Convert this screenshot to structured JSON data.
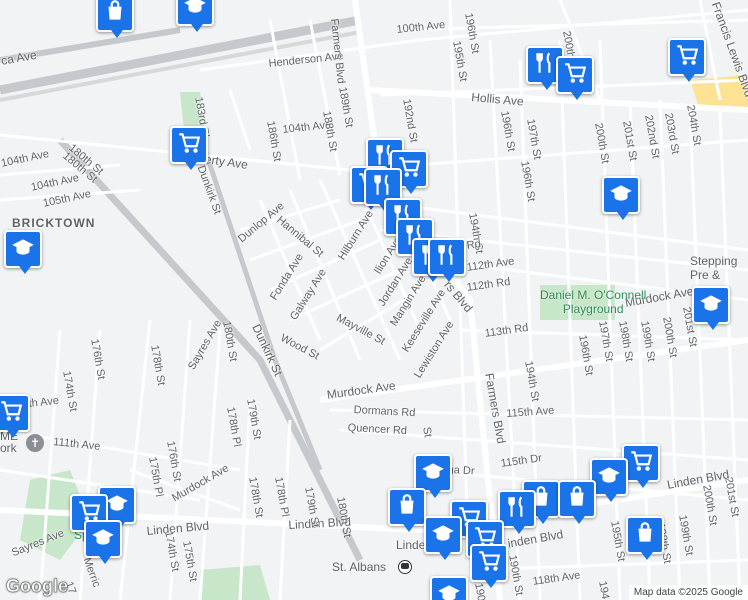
{
  "neighborhood": "BRICKTOWN",
  "streets": {
    "s100th_ave": "100th Ave",
    "henderson_ave": "Henderson Ave",
    "hollis_ave": "Hollis Ave",
    "farmers_blvd_top": "Farmers Blvd",
    "farmers_blvd_mid": "rs Blvd",
    "farmers_blvd_bottom": "Farmers Blvd",
    "s104th_ave_a": "104th Ave",
    "s104th_ave_b": "104th Ave",
    "s105th_ave": "105th Ave",
    "liberty_ave": "erty Ave",
    "s180th_st_top": "180th St",
    "s183rd_pl": "183rd Pl",
    "s186th_st": "186th St",
    "s188th_st": "188th St",
    "s189th_st": "189th St",
    "s192nd_st": "192nd St",
    "s195th_st": "195th St",
    "s196th_st_a": "196th St",
    "s196th_st_b": "196th St",
    "s196th_st_c": "196th St",
    "s197th_st": "197th St",
    "s200th_st_top": "200th",
    "s200th_st": "200th St",
    "s201st_st": "201st St",
    "s202nd_st": "202nd St",
    "s203rd_st": "203rd St",
    "s204th_st": "204th St",
    "francis_lewis": "Francis Lewis Blvd",
    "dunlop_ave": "Dunlop Ave",
    "hannibal_st": "Hannibal St",
    "hilburn_ave": "Hilburn Ave",
    "ilion_ave": "Ilion Ave",
    "jordan_ave": "Jordan Ave",
    "mangin_ave": "Mangin Ave",
    "keeseville_ave": "Keeseville Ave",
    "lewiston_ave": "Lewiston Ave",
    "fonda_ave": "Fonda Ave",
    "galway_ave": "Galway Ave",
    "mayville_st": "Mayville St",
    "wood_st": "Wood St",
    "dunkirk_st_top": "Dunkirk St",
    "dunkirk_st_bottom": "Dunkirk St",
    "s194th_st_top": "194th St",
    "s194th_st_bottom": "194th St",
    "s112th_ave": "112th Ave",
    "s112th_rd": "112th Rd",
    "s111th_rd": "Rd",
    "s113th_rd": "113th Rd",
    "murdock_ave_right": "Murdock Ave",
    "murdock_ave_main": "Murdock Ave",
    "murdock_ave_left": "Murdock Ave",
    "s115th_ave": "115th Ave",
    "s115th_dr": "115th Dr",
    "dormans_rd": "Dormans Rd",
    "quencer_rd": "Quencer Rd",
    "s198th_st": "198th St",
    "s199th_st": "199th St",
    "s200th_st_r": "200th St",
    "s201st_st_r": "201st St",
    "s196th_st_r": "196th St",
    "s197th_st_r": "197th St",
    "s195th_st_r": "195th St",
    "s194th_st_r": "194th St",
    "s198th_st_r": "198th St",
    "s199th_st_r": "199th St",
    "s200th_st_b": "200th St",
    "s201st_st_b": "201st St",
    "linden_blvd_right": "Linden Blvd",
    "linden_blvd_mid": "Linden Blvd",
    "linden_blvd_left": "Linden Blvd",
    "linden_blvd_center": "Linden",
    "s176th_st_a": "176th St",
    "s174th_st": "174th St",
    "s178th_st": "178th St",
    "sayres_ave": "Sayres Ave",
    "s180th_st_b": "180th St",
    "s179th_st": "179th St",
    "s178th_pl": "178th Pl",
    "s176th_st_b": "176th St",
    "s175th_pl": "175th Pl",
    "s178th_st_b": "178th St",
    "s178th_pl_b": "178th Pl",
    "s179th_st_b": "179th St",
    "s180th_st_c": "180th St",
    "s111th_ave": "111th Ave",
    "s174th_st_b": "174th St",
    "s175th_st": "175th St",
    "sayres_ave_b": "Sayres Ave",
    "merrick": "Merric",
    "s118th_ave": "118th Ave",
    "s190th_st": "190th St",
    "ca_ave": "ca Ave",
    "s180th_st_diag": "180th St",
    "s104th_ave_c": "104th Ave",
    "s190th_st_b": "St",
    "s190th_st_c": "190th S",
    "ga_dr": "ga Dr",
    "s194th_b": "194",
    "ave_frag": "th Ave",
    "s19_frag": "19",
    "s17_frag": "17"
  },
  "pois": {
    "park_name": "Daniel M. O'Connell\nPlayground",
    "stepping": "Stepping\nPre &",
    "station": "St. Albans",
    "spig": "Spig",
    "me": "ME\nork"
  },
  "attribution": "Map data ©2025 Google",
  "logo": "Google",
  "colors": {
    "background": "#f1f3f4",
    "road": "#ffffff",
    "major_road": "#ffffff",
    "park": "#c8e6c9",
    "pin": "#1a73e8",
    "rail": "#c5c8cc"
  },
  "pins": [
    {
      "icon": "shopping-bag-icon"
    },
    {
      "icon": "graduation-cap-icon"
    },
    {
      "icon": "restaurant-icon"
    },
    {
      "icon": "shopping-cart-icon"
    },
    {
      "icon": "shopping-cart-icon"
    },
    {
      "icon": "shopping-cart-icon"
    },
    {
      "icon": "restaurant-icon"
    },
    {
      "icon": "restaurant-icon"
    },
    {
      "icon": "restaurant-icon"
    },
    {
      "icon": "restaurant-icon"
    },
    {
      "icon": "restaurant-icon"
    },
    {
      "icon": "restaurant-icon"
    },
    {
      "icon": "graduation-cap-icon"
    },
    {
      "icon": "graduation-cap-icon"
    },
    {
      "icon": "graduation-cap-icon"
    },
    {
      "icon": "shopping-cart-icon"
    },
    {
      "icon": "shopping-cart-icon"
    },
    {
      "icon": "shopping-cart-icon"
    },
    {
      "icon": "graduation-cap-icon"
    },
    {
      "icon": "graduation-cap-icon"
    },
    {
      "icon": "shopping-cart-icon"
    },
    {
      "icon": "graduation-cap-icon"
    },
    {
      "icon": "shopping-bag-icon"
    },
    {
      "icon": "shopping-bag-icon"
    },
    {
      "icon": "shopping-bag-icon"
    },
    {
      "icon": "restaurant-icon"
    },
    {
      "icon": "shopping-cart-icon"
    },
    {
      "icon": "graduation-cap-icon"
    },
    {
      "icon": "shopping-cart-icon"
    },
    {
      "icon": "graduation-cap-icon"
    },
    {
      "icon": "shopping-bag-icon"
    }
  ]
}
